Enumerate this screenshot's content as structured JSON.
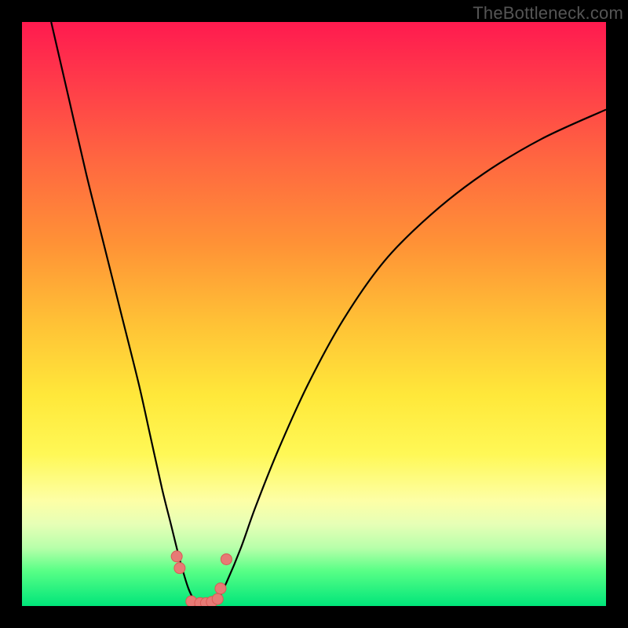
{
  "watermark": "TheBottleneck.com",
  "colors": {
    "line": "#000000",
    "dot_fill": "#e77a75",
    "dot_stroke": "#d95a55"
  },
  "chart_data": {
    "type": "line",
    "title": "",
    "xlabel": "",
    "ylabel": "",
    "xlim": [
      0,
      100
    ],
    "ylim": [
      0,
      100
    ],
    "series": [
      {
        "name": "left-curve",
        "x": [
          5,
          8,
          11,
          14,
          17,
          20,
          22,
          24,
          25.5,
          27,
          28.5,
          30
        ],
        "y": [
          100,
          87,
          74,
          62,
          50,
          38,
          29,
          20,
          14,
          8,
          3,
          0
        ]
      },
      {
        "name": "right-curve",
        "x": [
          33,
          35,
          37.5,
          40,
          44,
          49,
          55,
          62,
          70,
          79,
          89,
          100
        ],
        "y": [
          0,
          4,
          10,
          17,
          27,
          38,
          49,
          59,
          67,
          74,
          80,
          85
        ]
      }
    ],
    "points": {
      "name": "highlighted-points",
      "x": [
        26.5,
        27,
        29,
        30.5,
        31.5,
        32.5,
        33.5,
        34,
        35
      ],
      "y": [
        8.5,
        6.5,
        0.8,
        0.5,
        0.5,
        0.7,
        1.2,
        3,
        8
      ]
    }
  }
}
